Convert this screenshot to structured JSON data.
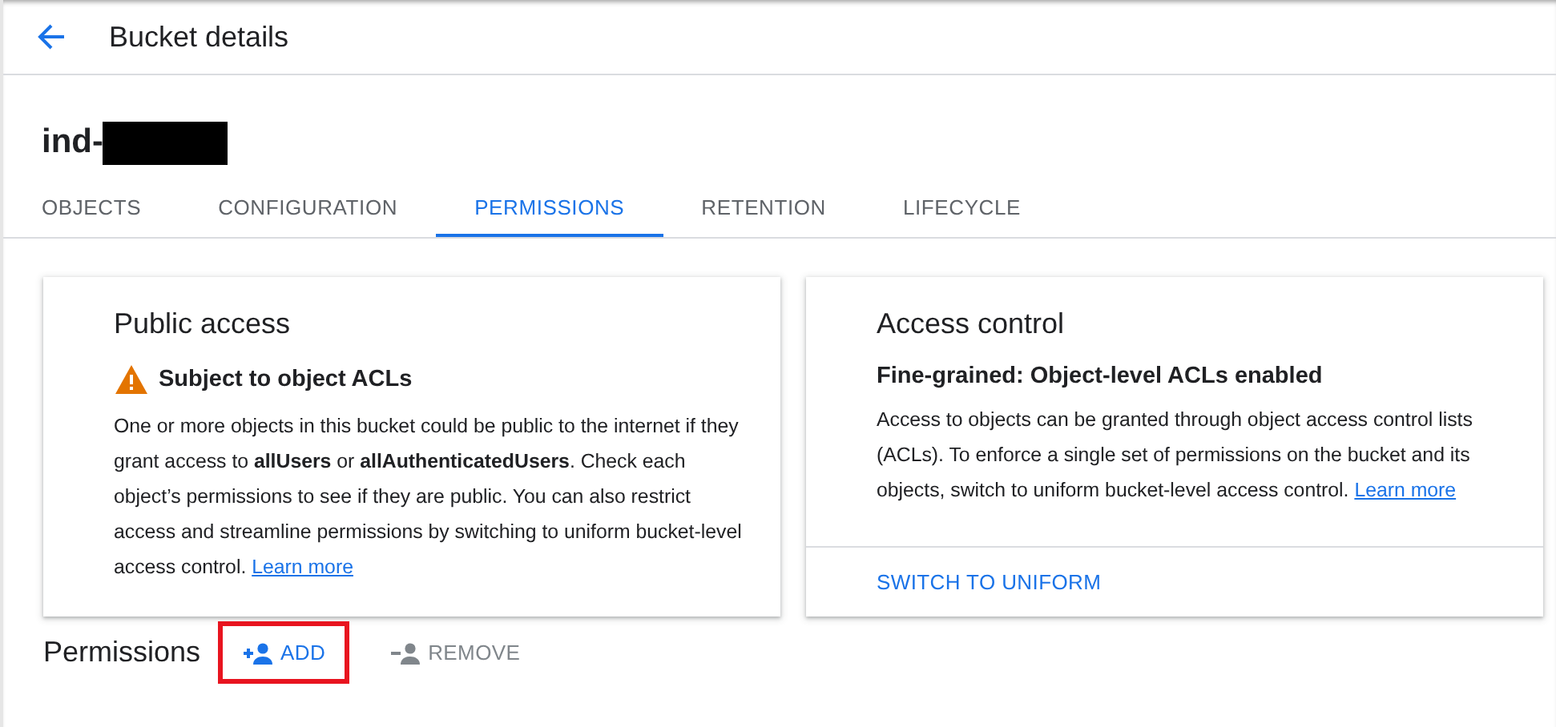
{
  "header": {
    "title": "Bucket details",
    "back_icon": true
  },
  "bucket": {
    "name": "ind-",
    "redacted": true
  },
  "tabs": [
    {
      "label": "OBJECTS",
      "selected": false
    },
    {
      "label": "CONFIGURATION",
      "selected": false
    },
    {
      "label": "PERMISSIONS",
      "selected": true
    },
    {
      "label": "RETENTION",
      "selected": false
    },
    {
      "label": "LIFECYCLE",
      "selected": false
    }
  ],
  "cards": [
    {
      "kind": "warning",
      "title": "Public access",
      "status": "Subject to object ACLs",
      "body": "One or more objects in this bucket could be public to the internet if they grant access to **allUsers** or **allAuthenticatedUsers**. Check each object’s permissions to see if they are public. You can also restrict access and streamline permissions by switching to uniform bucket-level access control.",
      "link": "Learn more"
    },
    {
      "kind": "plain",
      "title": "Access control",
      "status": "Fine-grained: Object-level ACLs enabled",
      "body": "Access to objects can be granted through object access control lists (ACLs). To enforce a single set of permissions on the bucket and its objects, switch to uniform bucket-level access control.",
      "link": "Learn more",
      "action": "SWITCH TO UNIFORM"
    }
  ],
  "permissions": {
    "title": "Permissions",
    "actions": [
      {
        "kind": "add",
        "label": "ADD",
        "disabled": false,
        "highlighted": true
      },
      {
        "kind": "remove",
        "label": "REMOVE",
        "disabled": true,
        "highlighted": false
      }
    ]
  }
}
